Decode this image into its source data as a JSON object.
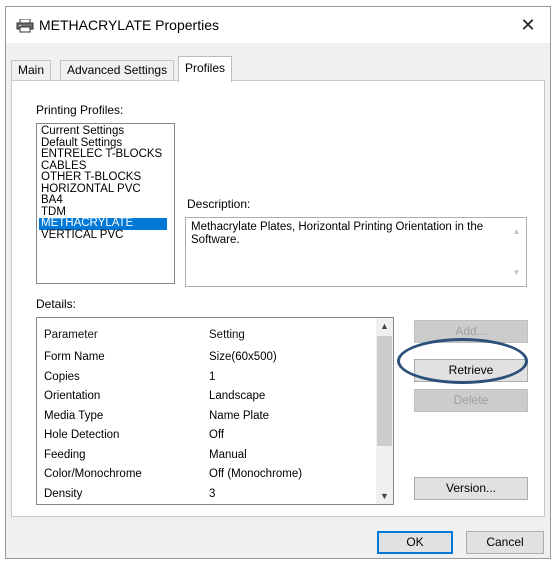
{
  "window": {
    "title": "METHACRYLATE Properties",
    "close_glyph": "✕",
    "icon": "printer-icon"
  },
  "tabs": [
    {
      "label": "Main",
      "active": false
    },
    {
      "label": "Advanced Settings",
      "active": false
    },
    {
      "label": "Profiles",
      "active": true
    }
  ],
  "profiles": {
    "label": "Printing Profiles:",
    "items": [
      "Current Settings",
      "Default Settings",
      "ENTRELEC T-BLOCKS",
      "CABLES",
      "OTHER T-BLOCKS",
      "HORIZONTAL PVC",
      "BA4",
      "TDM",
      "METHACRYLATE",
      "VERTICAL PVC"
    ],
    "selected": "METHACRYLATE"
  },
  "description": {
    "label": "Description:",
    "text": "Methacrylate Plates, Horizontal Printing Orientation in the Software."
  },
  "details": {
    "label": "Details:",
    "columns": {
      "parameter": "Parameter",
      "setting": "Setting"
    },
    "rows": [
      {
        "parameter": "Form Name",
        "setting": "Size(60x500)"
      },
      {
        "parameter": "Copies",
        "setting": "1"
      },
      {
        "parameter": "Orientation",
        "setting": "Landscape"
      },
      {
        "parameter": "Media Type",
        "setting": "Name Plate"
      },
      {
        "parameter": "Hole Detection",
        "setting": "Off"
      },
      {
        "parameter": "Feeding",
        "setting": "Manual"
      },
      {
        "parameter": "Color/Monochrome",
        "setting": "Off (Monochrome)"
      },
      {
        "parameter": "Density",
        "setting": "3"
      }
    ]
  },
  "buttons": {
    "add": "Add...",
    "retrieve": "Retrieve",
    "delete": "Delete",
    "version": "Version...",
    "ok": "OK",
    "cancel": "Cancel"
  },
  "colors": {
    "selection": "#0078d7",
    "highlight_oval": "#2b5079"
  }
}
